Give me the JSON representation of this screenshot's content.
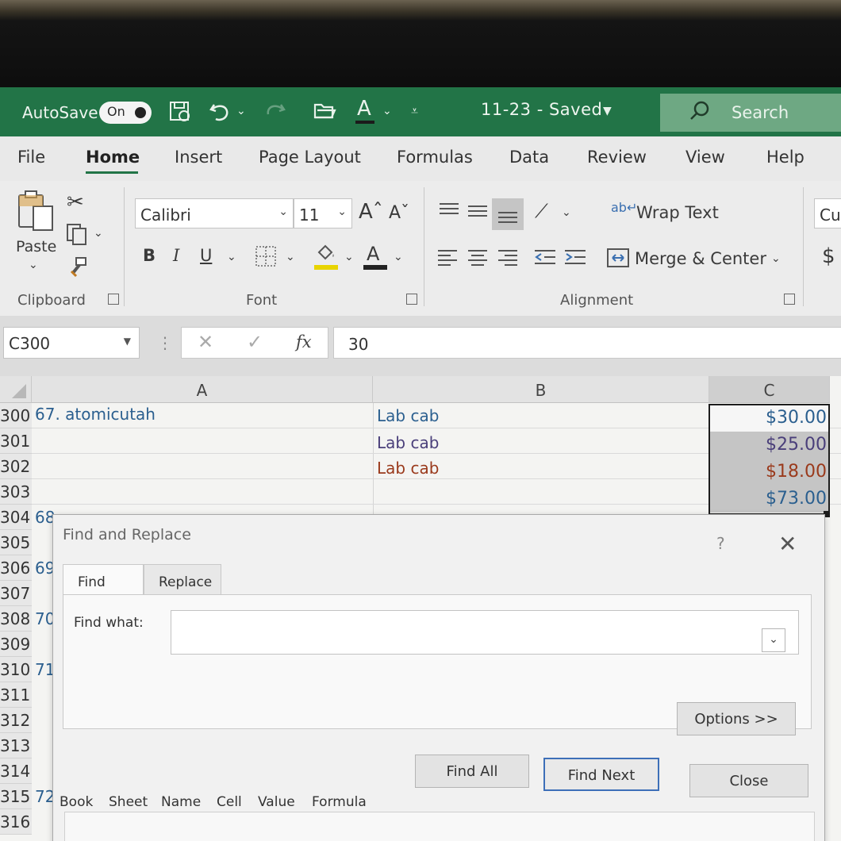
{
  "titlebar": {
    "autosave_label": "AutoSave",
    "autosave_state": "On",
    "document_title": "11-23 - Saved",
    "search_label": "Search",
    "accent_color": "#227447"
  },
  "ribbon_tabs": [
    "File",
    "Home",
    "Insert",
    "Page Layout",
    "Formulas",
    "Data",
    "Review",
    "View",
    "Help"
  ],
  "active_tab": "Home",
  "clipboard": {
    "paste_label": "Paste",
    "group_label": "Clipboard"
  },
  "font": {
    "font_name": "Calibri",
    "font_size": "11",
    "bold": "B",
    "italic": "I",
    "underline": "U",
    "color_letter": "A",
    "group_label": "Font"
  },
  "alignment": {
    "wrap_text_label": "Wrap Text",
    "merge_center_label": "Merge & Center",
    "group_label": "Alignment"
  },
  "number": {
    "format_label": "Cu",
    "currency_symbol": "$"
  },
  "formula_bar": {
    "name_box": "C300",
    "fx_symbol": "fx",
    "value": "30"
  },
  "grid": {
    "columns": [
      "A",
      "B",
      "C"
    ],
    "rows": [
      {
        "num": "300",
        "a": "67. atomicutah",
        "b": "Lab cab",
        "c": "$30.00"
      },
      {
        "num": "301",
        "a": "",
        "b": "Lab cab",
        "c": "$25.00"
      },
      {
        "num": "302",
        "a": "",
        "b": "Lab cab",
        "c": "$18.00"
      },
      {
        "num": "303",
        "a": "",
        "b": "",
        "c": "$73.00"
      },
      {
        "num": "304",
        "a": "68",
        "b": "",
        "c": ""
      },
      {
        "num": "305",
        "a": "",
        "b": "",
        "c": ""
      },
      {
        "num": "306",
        "a": "69",
        "b": "",
        "c": ""
      },
      {
        "num": "307",
        "a": "",
        "b": "",
        "c": ""
      },
      {
        "num": "308",
        "a": "70",
        "b": "",
        "c": ""
      },
      {
        "num": "309",
        "a": "",
        "b": "",
        "c": ""
      },
      {
        "num": "310",
        "a": "71",
        "b": "",
        "c": ""
      },
      {
        "num": "311",
        "a": "",
        "b": "",
        "c": ""
      },
      {
        "num": "312",
        "a": "",
        "b": "",
        "c": ""
      },
      {
        "num": "313",
        "a": "",
        "b": "",
        "c": ""
      },
      {
        "num": "314",
        "a": "",
        "b": "",
        "c": ""
      },
      {
        "num": "315",
        "a": "72",
        "b": "",
        "c": ""
      },
      {
        "num": "316",
        "a": "",
        "b": "",
        "c": ""
      }
    ],
    "colors": {
      "blue_text": "#2b5f8f",
      "purple_text": "#4a3f7a",
      "red_text": "#9a3a1c"
    }
  },
  "dialog": {
    "title": "Find and Replace",
    "help": "?",
    "close": "✕",
    "tabs": [
      "Find",
      "Replace"
    ],
    "find_label": "Find what:",
    "find_value": "",
    "options_label": "Options >>",
    "find_all_label": "Find All",
    "find_next_label": "Find Next",
    "close_label": "Close",
    "result_columns": [
      "Book",
      "Sheet",
      "Name",
      "Cell",
      "Value",
      "Formula"
    ]
  }
}
